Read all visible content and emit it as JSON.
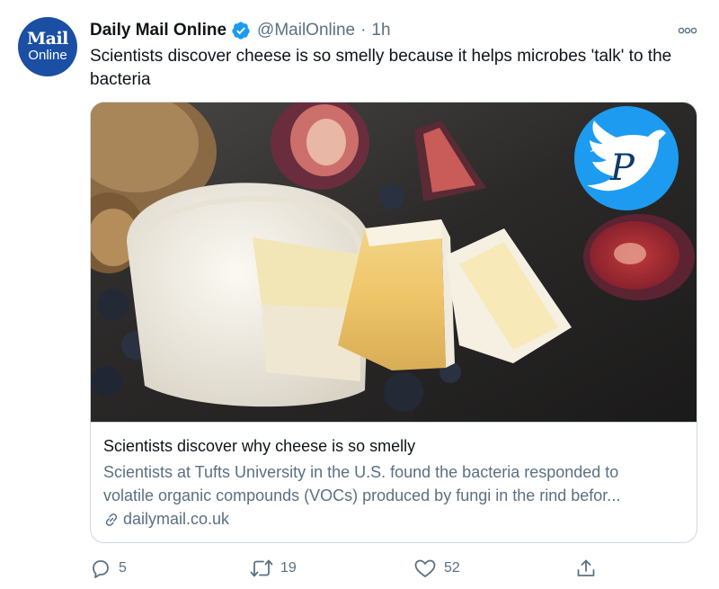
{
  "avatar": {
    "line1": "Mail",
    "line2": "Online"
  },
  "account": {
    "name": "Daily Mail Online",
    "handle": "@MailOnline",
    "separator": "·",
    "time": "1h"
  },
  "tweet": {
    "text": "Scientists discover cheese is so smelly because it helps microbes 'talk' to the bacteria"
  },
  "link_card": {
    "title": "Scientists discover why cheese is so smelly",
    "description_line1": "Scientists at Tufts University in the U.S. found the bacteria responded to",
    "description_line2": "volatile organic compounds (VOCs) produced by fungi in the rind befor...",
    "domain": "dailymail.co.uk",
    "watermark_letter": "P"
  },
  "actions": {
    "reply_count": "5",
    "retweet_count": "19",
    "like_count": "52"
  },
  "icons": [
    "verified-icon",
    "more-icon",
    "link-icon",
    "reply-icon",
    "retweet-icon",
    "like-icon",
    "share-icon",
    "bird-icon"
  ],
  "colors": {
    "accent": "#1d9bf0",
    "avatar_bg": "#1a4fa3",
    "secondary_text": "#5b7083",
    "border": "#cfd9de"
  }
}
